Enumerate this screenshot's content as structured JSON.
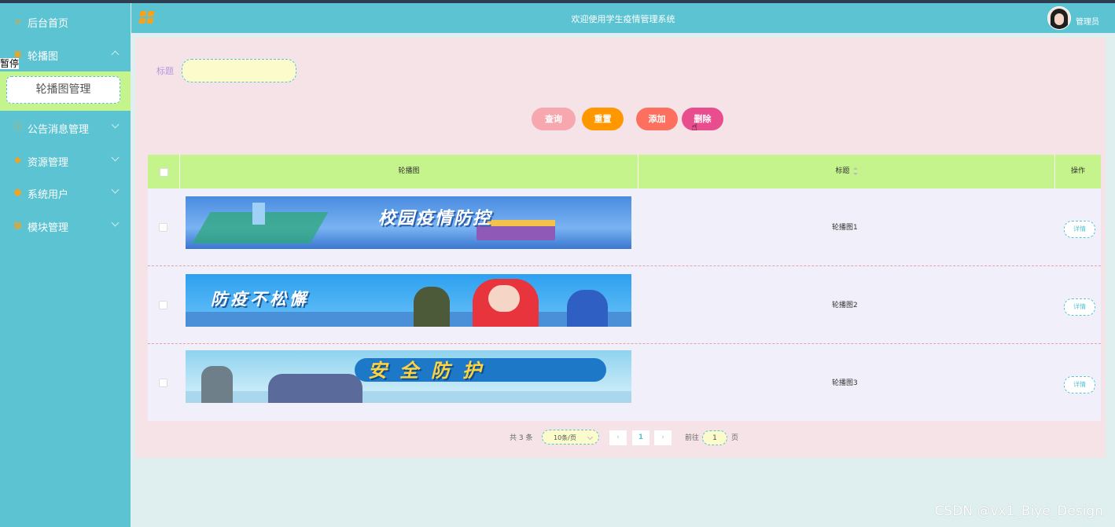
{
  "header": {
    "title": "欢迎使用学生疫情管理系统",
    "admin": "管理员",
    "avatar_icon": "user-avatar"
  },
  "sidebar": {
    "items": [
      {
        "label": "后台首页",
        "icon": "home-icon"
      },
      {
        "label": "轮播图",
        "icon": "image-icon",
        "expanded": true
      },
      {
        "label": "公告消息管理",
        "icon": "info-icon"
      },
      {
        "label": "资源管理",
        "icon": "pin-icon"
      },
      {
        "label": "系统用户",
        "icon": "user-icon"
      },
      {
        "label": "模块管理",
        "icon": "grid-icon"
      }
    ],
    "submenu": {
      "label": "轮播图管理"
    },
    "floating_text": "暂停"
  },
  "filter": {
    "label": "标题",
    "value": ""
  },
  "toolbar": {
    "query": "查询",
    "reset": "重置",
    "add": "添加",
    "delete": "删除"
  },
  "table": {
    "headers": [
      "轮播图",
      "标题",
      "操作"
    ],
    "rows": [
      {
        "banner_text": "校园疫情防控",
        "title": "轮播图1",
        "action": "详情"
      },
      {
        "banner_text": "防疫不松懈",
        "title": "轮播图2",
        "action": "详情"
      },
      {
        "banner_text": "安全防护",
        "title": "轮播图3",
        "action": "详情"
      }
    ]
  },
  "pagination": {
    "total": "共 3 条",
    "page_size": "10条/页",
    "current": "1",
    "goto_label": "前往",
    "goto_value": "1",
    "page_suffix": "页"
  },
  "watermark": "CSDN @vx1_Biye_Design",
  "colors": {
    "sidebar": "#5bc3d2",
    "header": "#5bc3d2",
    "panel": "#f5e3e7",
    "table_header": "#c6f48c",
    "accent_orange": "#ff9800"
  }
}
